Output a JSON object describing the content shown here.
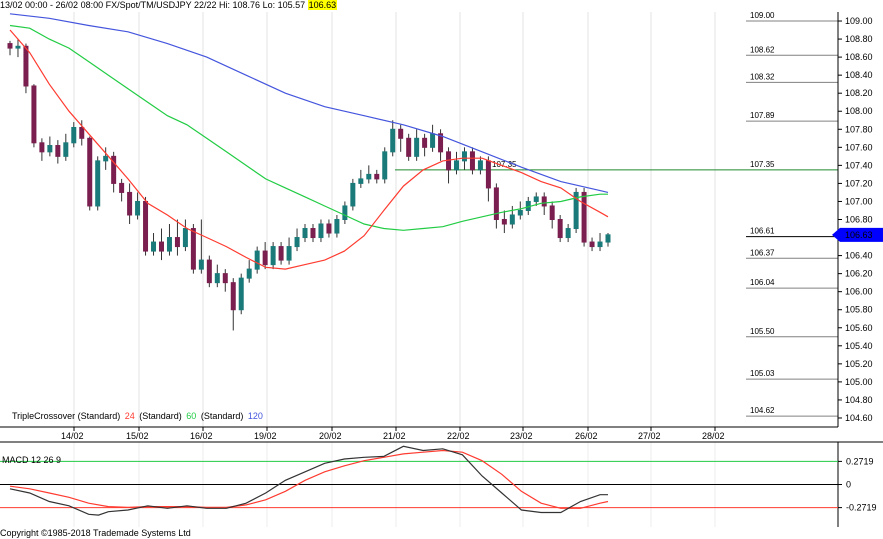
{
  "header": {
    "range": "13/02 00:00 - 26/02 08:00",
    "instrument": "FX/Spot/TM/USDJPY 22/22",
    "hi": "Hi: 108.76",
    "lo": "Lo: 105.57",
    "last": "106.63"
  },
  "footer": {
    "copyright": "Copyright ©1985-2018 Trademade Systems Ltd"
  },
  "indicator": {
    "name": "TripleCrossover (Standard)",
    "p1": "24",
    "p1_label": "(Standard)",
    "p2": "60",
    "p2_label": "(Standard)",
    "p3": "120"
  },
  "macd": {
    "label": "MACD 12 26 9",
    "ticks": [
      "0.2719",
      "0",
      "-0.2719"
    ]
  },
  "colors": {
    "candle_up": "#1a7a7a",
    "candle_down": "#7a1f4f",
    "ma24": "#ff3b30",
    "ma60": "#22cc44",
    "ma120": "#4455dd",
    "macd_line": "#333333",
    "macd_signal": "#ff3b30",
    "current_tag": "#0000ff",
    "level_line": "#808080",
    "crossover_line": "#1f8a2f"
  },
  "chart_data": {
    "type": "candlestick",
    "ylim": [
      104.5,
      109.1
    ],
    "y_ticks": [
      "109.00",
      "108.80",
      "108.60",
      "108.40",
      "108.20",
      "108.00",
      "107.80",
      "107.60",
      "107.40",
      "107.20",
      "107.00",
      "106.80",
      "106.60",
      "106.40",
      "106.20",
      "106.00",
      "105.80",
      "105.60",
      "105.40",
      "105.20",
      "105.00",
      "104.80",
      "104.60"
    ],
    "x_labels": [
      "14/02",
      "15/02",
      "16/02",
      "19/02",
      "20/02",
      "21/02",
      "22/02",
      "23/02",
      "26/02",
      "27/02",
      "28/02"
    ],
    "current_price": "106.63",
    "levels": [
      {
        "label": "109.00",
        "value": 109.0
      },
      {
        "label": "108.62",
        "value": 108.62
      },
      {
        "label": "108.32",
        "value": 108.32
      },
      {
        "label": "107.89",
        "value": 107.89
      },
      {
        "label": "107.35",
        "value": 107.35
      },
      {
        "label": "106.61",
        "value": 106.61
      },
      {
        "label": "106.37",
        "value": 106.37
      },
      {
        "label": "106.04",
        "value": 106.04
      },
      {
        "label": "105.50",
        "value": 105.5
      },
      {
        "label": "105.03",
        "value": 105.03
      },
      {
        "label": "104.62",
        "value": 104.62
      }
    ],
    "crossover": {
      "label": "107.35",
      "value": 107.35
    },
    "candles": [
      [
        108.75,
        108.7,
        108.78,
        108.62
      ],
      [
        108.7,
        108.72,
        108.8,
        108.6
      ],
      [
        108.72,
        108.28,
        108.75,
        108.2
      ],
      [
        108.28,
        107.65,
        108.3,
        107.6
      ],
      [
        107.65,
        107.55,
        107.7,
        107.45
      ],
      [
        107.55,
        107.62,
        107.72,
        107.5
      ],
      [
        107.62,
        107.5,
        107.68,
        107.42
      ],
      [
        107.5,
        107.65,
        107.75,
        107.45
      ],
      [
        107.65,
        107.82,
        107.88,
        107.6
      ],
      [
        107.82,
        107.7,
        107.9,
        107.62
      ],
      [
        107.7,
        106.95,
        107.72,
        106.9
      ],
      [
        106.95,
        107.45,
        107.5,
        106.9
      ],
      [
        107.45,
        107.5,
        107.6,
        107.35
      ],
      [
        107.5,
        107.2,
        107.55,
        107.1
      ],
      [
        107.2,
        107.1,
        107.25,
        107.0
      ],
      [
        107.1,
        106.85,
        107.2,
        106.75
      ],
      [
        106.85,
        107.0,
        107.1,
        106.8
      ],
      [
        107.0,
        106.45,
        107.05,
        106.4
      ],
      [
        106.45,
        106.55,
        106.65,
        106.4
      ],
      [
        106.55,
        106.45,
        106.7,
        106.35
      ],
      [
        106.45,
        106.6,
        106.75,
        106.4
      ],
      [
        106.6,
        106.5,
        106.8,
        106.4
      ],
      [
        106.5,
        106.7,
        106.8,
        106.45
      ],
      [
        106.7,
        106.25,
        106.75,
        106.2
      ],
      [
        106.25,
        106.35,
        106.8,
        106.2
      ],
      [
        106.35,
        106.1,
        106.4,
        106.05
      ],
      [
        106.1,
        106.2,
        106.3,
        106.05
      ],
      [
        106.2,
        106.1,
        106.25,
        106.0
      ],
      [
        106.1,
        105.8,
        106.15,
        105.57
      ],
      [
        105.8,
        106.15,
        106.2,
        105.75
      ],
      [
        106.15,
        106.25,
        106.35,
        106.1
      ],
      [
        106.25,
        106.45,
        106.5,
        106.2
      ],
      [
        106.45,
        106.3,
        106.55,
        106.25
      ],
      [
        106.3,
        106.5,
        106.55,
        106.25
      ],
      [
        106.5,
        106.35,
        106.55,
        106.3
      ],
      [
        106.35,
        106.5,
        106.6,
        106.3
      ],
      [
        106.5,
        106.6,
        106.7,
        106.45
      ],
      [
        106.6,
        106.7,
        106.75,
        106.55
      ],
      [
        106.7,
        106.6,
        106.75,
        106.55
      ],
      [
        106.6,
        106.75,
        106.8,
        106.55
      ],
      [
        106.75,
        106.65,
        106.8,
        106.6
      ],
      [
        106.65,
        106.8,
        106.85,
        106.6
      ],
      [
        106.8,
        106.95,
        107.0,
        106.75
      ],
      [
        106.95,
        107.2,
        107.25,
        106.9
      ],
      [
        107.2,
        107.25,
        107.35,
        107.15
      ],
      [
        107.25,
        107.3,
        107.4,
        107.2
      ],
      [
        107.3,
        107.25,
        107.35,
        107.2
      ],
      [
        107.25,
        107.55,
        107.6,
        107.2
      ],
      [
        107.55,
        107.8,
        107.9,
        107.5
      ],
      [
        107.8,
        107.7,
        107.85,
        107.55
      ],
      [
        107.7,
        107.5,
        107.75,
        107.45
      ],
      [
        107.5,
        107.7,
        107.8,
        107.45
      ],
      [
        107.7,
        107.6,
        107.75,
        107.5
      ],
      [
        107.6,
        107.75,
        107.85,
        107.55
      ],
      [
        107.75,
        107.55,
        107.8,
        107.45
      ],
      [
        107.55,
        107.35,
        107.6,
        107.2
      ],
      [
        107.35,
        107.45,
        107.55,
        107.3
      ],
      [
        107.45,
        107.55,
        107.6,
        107.35
      ],
      [
        107.55,
        107.35,
        107.6,
        107.3
      ],
      [
        107.35,
        107.45,
        107.5,
        107.3
      ],
      [
        107.45,
        107.15,
        107.5,
        107.0
      ],
      [
        107.15,
        106.8,
        107.2,
        106.7
      ],
      [
        106.8,
        106.75,
        106.9,
        106.65
      ],
      [
        106.75,
        106.85,
        106.95,
        106.7
      ],
      [
        106.85,
        106.9,
        107.0,
        106.8
      ],
      [
        106.9,
        107.0,
        107.05,
        106.85
      ],
      [
        107.0,
        107.05,
        107.1,
        106.95
      ],
      [
        107.05,
        106.95,
        107.1,
        106.85
      ],
      [
        106.95,
        106.8,
        107.0,
        106.7
      ],
      [
        106.8,
        106.6,
        106.85,
        106.55
      ],
      [
        106.6,
        106.7,
        106.75,
        106.55
      ],
      [
        106.7,
        107.1,
        107.15,
        106.65
      ],
      [
        107.1,
        106.55,
        107.15,
        106.5
      ],
      [
        106.55,
        106.5,
        106.6,
        106.45
      ],
      [
        106.5,
        106.55,
        106.65,
        106.45
      ],
      [
        106.55,
        106.63,
        106.65,
        106.5
      ]
    ],
    "ma24": [
      [
        0,
        108.9
      ],
      [
        20,
        108.65
      ],
      [
        40,
        108.3
      ],
      [
        60,
        108.0
      ],
      [
        80,
        107.75
      ],
      [
        100,
        107.5
      ],
      [
        120,
        107.25
      ],
      [
        140,
        106.98
      ],
      [
        160,
        106.85
      ],
      [
        180,
        106.7
      ],
      [
        200,
        106.6
      ],
      [
        220,
        106.5
      ],
      [
        240,
        106.38
      ],
      [
        260,
        106.27
      ],
      [
        280,
        106.25
      ],
      [
        300,
        106.3
      ],
      [
        320,
        106.35
      ],
      [
        340,
        106.45
      ],
      [
        360,
        106.62
      ],
      [
        380,
        106.9
      ],
      [
        400,
        107.17
      ],
      [
        420,
        107.35
      ],
      [
        440,
        107.45
      ],
      [
        460,
        107.48
      ],
      [
        480,
        107.48
      ],
      [
        500,
        107.4
      ],
      [
        520,
        107.32
      ],
      [
        540,
        107.22
      ],
      [
        560,
        107.15
      ],
      [
        580,
        107.0
      ],
      [
        600,
        106.88
      ],
      [
        608,
        106.83
      ]
    ],
    "ma60": [
      [
        0,
        108.95
      ],
      [
        20,
        108.92
      ],
      [
        40,
        108.8
      ],
      [
        60,
        108.7
      ],
      [
        80,
        108.55
      ],
      [
        100,
        108.4
      ],
      [
        120,
        108.25
      ],
      [
        140,
        108.1
      ],
      [
        160,
        107.95
      ],
      [
        180,
        107.85
      ],
      [
        200,
        107.7
      ],
      [
        220,
        107.55
      ],
      [
        240,
        107.4
      ],
      [
        260,
        107.25
      ],
      [
        280,
        107.15
      ],
      [
        300,
        107.05
      ],
      [
        320,
        106.95
      ],
      [
        340,
        106.85
      ],
      [
        360,
        106.75
      ],
      [
        380,
        106.7
      ],
      [
        400,
        106.68
      ],
      [
        420,
        106.7
      ],
      [
        440,
        106.72
      ],
      [
        460,
        106.78
      ],
      [
        480,
        106.83
      ],
      [
        500,
        106.88
      ],
      [
        520,
        106.92
      ],
      [
        540,
        106.98
      ],
      [
        560,
        107.0
      ],
      [
        580,
        107.05
      ],
      [
        600,
        107.08
      ],
      [
        608,
        107.08
      ]
    ],
    "ma120": [
      [
        0,
        109.08
      ],
      [
        40,
        109.03
      ],
      [
        80,
        108.95
      ],
      [
        120,
        108.88
      ],
      [
        160,
        108.75
      ],
      [
        200,
        108.6
      ],
      [
        240,
        108.4
      ],
      [
        280,
        108.2
      ],
      [
        320,
        108.05
      ],
      [
        360,
        107.95
      ],
      [
        400,
        107.85
      ],
      [
        440,
        107.72
      ],
      [
        480,
        107.55
      ],
      [
        520,
        107.38
      ],
      [
        560,
        107.22
      ],
      [
        600,
        107.12
      ],
      [
        608,
        107.1
      ]
    ],
    "macd_line": [
      [
        0,
        -0.05
      ],
      [
        20,
        -0.1
      ],
      [
        40,
        -0.2
      ],
      [
        60,
        -0.25
      ],
      [
        80,
        -0.35
      ],
      [
        90,
        -0.36
      ],
      [
        100,
        -0.32
      ],
      [
        120,
        -0.3
      ],
      [
        140,
        -0.25
      ],
      [
        160,
        -0.28
      ],
      [
        180,
        -0.25
      ],
      [
        200,
        -0.28
      ],
      [
        220,
        -0.28
      ],
      [
        240,
        -0.22
      ],
      [
        260,
        -0.1
      ],
      [
        280,
        0.05
      ],
      [
        300,
        0.15
      ],
      [
        320,
        0.25
      ],
      [
        340,
        0.3
      ],
      [
        360,
        0.32
      ],
      [
        380,
        0.33
      ],
      [
        400,
        0.45
      ],
      [
        420,
        0.4
      ],
      [
        440,
        0.42
      ],
      [
        460,
        0.35
      ],
      [
        480,
        0.1
      ],
      [
        500,
        -0.1
      ],
      [
        520,
        -0.3
      ],
      [
        540,
        -0.33
      ],
      [
        560,
        -0.33
      ],
      [
        580,
        -0.2
      ],
      [
        600,
        -0.12
      ],
      [
        608,
        -0.12
      ]
    ],
    "macd_signal": [
      [
        0,
        -0.02
      ],
      [
        20,
        -0.05
      ],
      [
        40,
        -0.1
      ],
      [
        60,
        -0.15
      ],
      [
        80,
        -0.22
      ],
      [
        100,
        -0.26
      ],
      [
        120,
        -0.27
      ],
      [
        140,
        -0.26
      ],
      [
        160,
        -0.26
      ],
      [
        180,
        -0.26
      ],
      [
        200,
        -0.27
      ],
      [
        220,
        -0.27
      ],
      [
        240,
        -0.24
      ],
      [
        260,
        -0.18
      ],
      [
        280,
        -0.08
      ],
      [
        300,
        0.05
      ],
      [
        320,
        0.15
      ],
      [
        340,
        0.22
      ],
      [
        360,
        0.28
      ],
      [
        380,
        0.32
      ],
      [
        400,
        0.36
      ],
      [
        420,
        0.38
      ],
      [
        440,
        0.4
      ],
      [
        460,
        0.38
      ],
      [
        480,
        0.28
      ],
      [
        500,
        0.12
      ],
      [
        520,
        -0.08
      ],
      [
        540,
        -0.22
      ],
      [
        560,
        -0.28
      ],
      [
        580,
        -0.28
      ],
      [
        600,
        -0.22
      ],
      [
        608,
        -0.2
      ]
    ]
  }
}
